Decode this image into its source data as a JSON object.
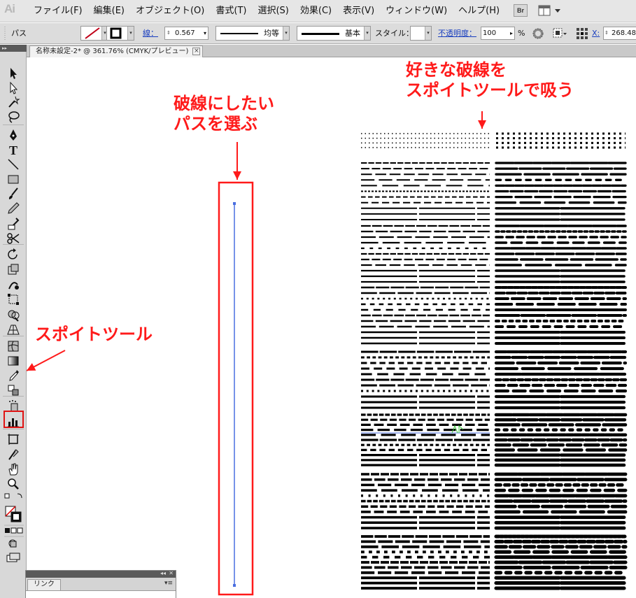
{
  "app": {
    "logo": "Ai"
  },
  "menu": [
    "ファイル(F)",
    "編集(E)",
    "オブジェクト(O)",
    "書式(T)",
    "選択(S)",
    "効果(C)",
    "表示(V)",
    "ウィンドウ(W)",
    "ヘルプ(H)"
  ],
  "menubar_right": {
    "bridge_label": "Br"
  },
  "control": {
    "selection_label": "パス",
    "stroke_label": "線",
    "stroke_weight": "0.567",
    "profile_label": "均等",
    "brush_label": "基本",
    "style_label": "スタイル",
    "opacity_label": "不透明度",
    "opacity_value": "100",
    "percent": "%",
    "x_label": "X",
    "x_value": "268.48"
  },
  "document": {
    "tab_title": "名称未設定-2* @ 361.76% (CMYK/プレビュー)",
    "close_glyph": "×"
  },
  "annotations": {
    "target_dash_line1": "好きな破線を",
    "target_dash_line2": "スポイトツールで吸う",
    "select_path_line1": "破線にしたい",
    "select_path_line2": "パスを選ぶ",
    "eyedropper": "スポイトツール",
    "accent_color": "#ff1a1a"
  },
  "tools": [
    "selection-arrow-icon",
    "direct-selection-icon",
    "magic-wand-icon",
    "lasso-icon",
    "pen-icon",
    "type-icon",
    "line-segment-icon",
    "rectangle-icon",
    "paintbrush-icon",
    "pencil-icon",
    "blob-brush-icon",
    "scissors-icon",
    "rotate-icon",
    "scale-icon",
    "warp-icon",
    "free-transform-icon",
    "shape-builder-icon",
    "perspective-grid-icon",
    "mesh-icon",
    "gradient-icon",
    "eyedropper-icon",
    "blend-icon",
    "symbol-sprayer-icon",
    "column-graph-icon",
    "artboard-icon",
    "slice-icon",
    "hand-icon",
    "zoom-icon"
  ],
  "links_panel": {
    "tab_label": "リンク",
    "menu_glyph": "▾≡",
    "collapse_glyph": "◂◂",
    "close_glyph": "✕"
  },
  "selection_color": "#4a6ee0"
}
